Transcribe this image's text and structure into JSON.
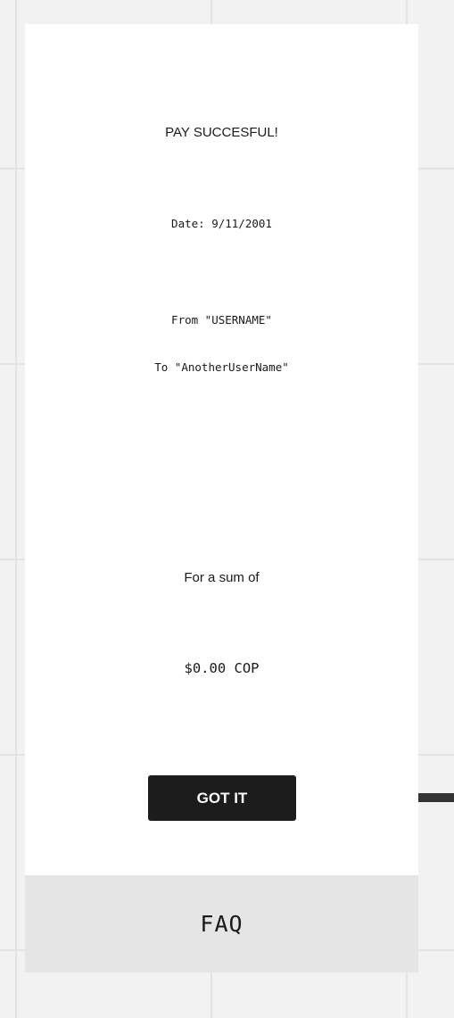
{
  "receipt": {
    "title": "PAY SUCCESFUL!",
    "date": "Date: 9/11/2001",
    "from": "From \"USERNAME\"",
    "to": "To \"AnotherUserName\"",
    "sum_label": "For a sum of",
    "amount": "$0.00 COP",
    "confirm_label": "GOT IT"
  },
  "footer": {
    "faq_label": "FAQ"
  },
  "colors": {
    "background": "#f2f2f2",
    "card": "#ffffff",
    "button": "#1c1c1c",
    "connector": "#333333",
    "faq_bar": "#e5e5e5"
  }
}
